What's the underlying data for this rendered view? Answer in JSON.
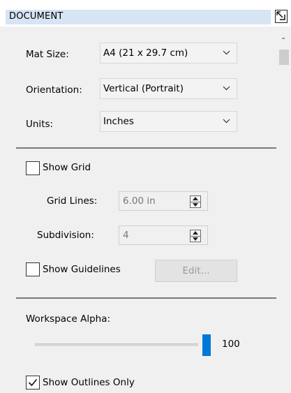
{
  "header": {
    "title": "DOCUMENT",
    "expand_icon": "expand-icon"
  },
  "document": {
    "mat_size": {
      "label": "Mat Size:",
      "value": "A4 (21 x 29.7 cm)"
    },
    "orientation": {
      "label": "Orientation:",
      "value": "Vertical (Portrait)"
    },
    "units": {
      "label": "Units:",
      "value": "Inches"
    }
  },
  "grid": {
    "show_grid": {
      "label": "Show Grid",
      "checked": false
    },
    "grid_lines": {
      "label": "Grid Lines:",
      "value": "6.00 in"
    },
    "subdivision": {
      "label": "Subdivision:",
      "value": "4"
    },
    "show_guidelines": {
      "label": "Show Guidelines",
      "checked": false
    },
    "edit_button": "Edit..."
  },
  "workspace": {
    "alpha_label": "Workspace Alpha:",
    "alpha_value": "100",
    "alpha_fraction": 1.0,
    "show_outlines_only": {
      "label": "Show Outlines Only",
      "checked": true
    }
  },
  "colors": {
    "accent": "#0078d7",
    "header_bar": "#d6e4f4"
  }
}
